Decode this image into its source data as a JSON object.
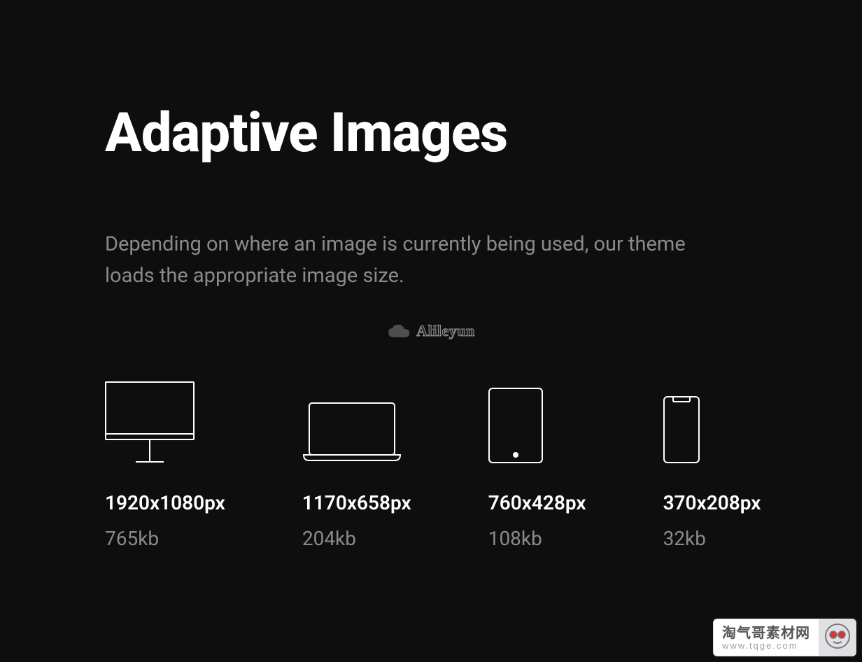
{
  "heading": "Adaptive Images",
  "subheading": "Depending on where an image is currently being used, our theme loads the appropriate image size.",
  "center_watermark": "Alileyun",
  "devices": [
    {
      "icon": "desktop-icon",
      "dimensions": "1920x1080px",
      "filesize": "765kb"
    },
    {
      "icon": "laptop-icon",
      "dimensions": "1170x658px",
      "filesize": "204kb"
    },
    {
      "icon": "tablet-icon",
      "dimensions": "760x428px",
      "filesize": "108kb"
    },
    {
      "icon": "phone-icon",
      "dimensions": "370x208px",
      "filesize": "32kb"
    }
  ],
  "footer_badge": {
    "title": "淘气哥素材网",
    "url": "www.tqge.com"
  }
}
